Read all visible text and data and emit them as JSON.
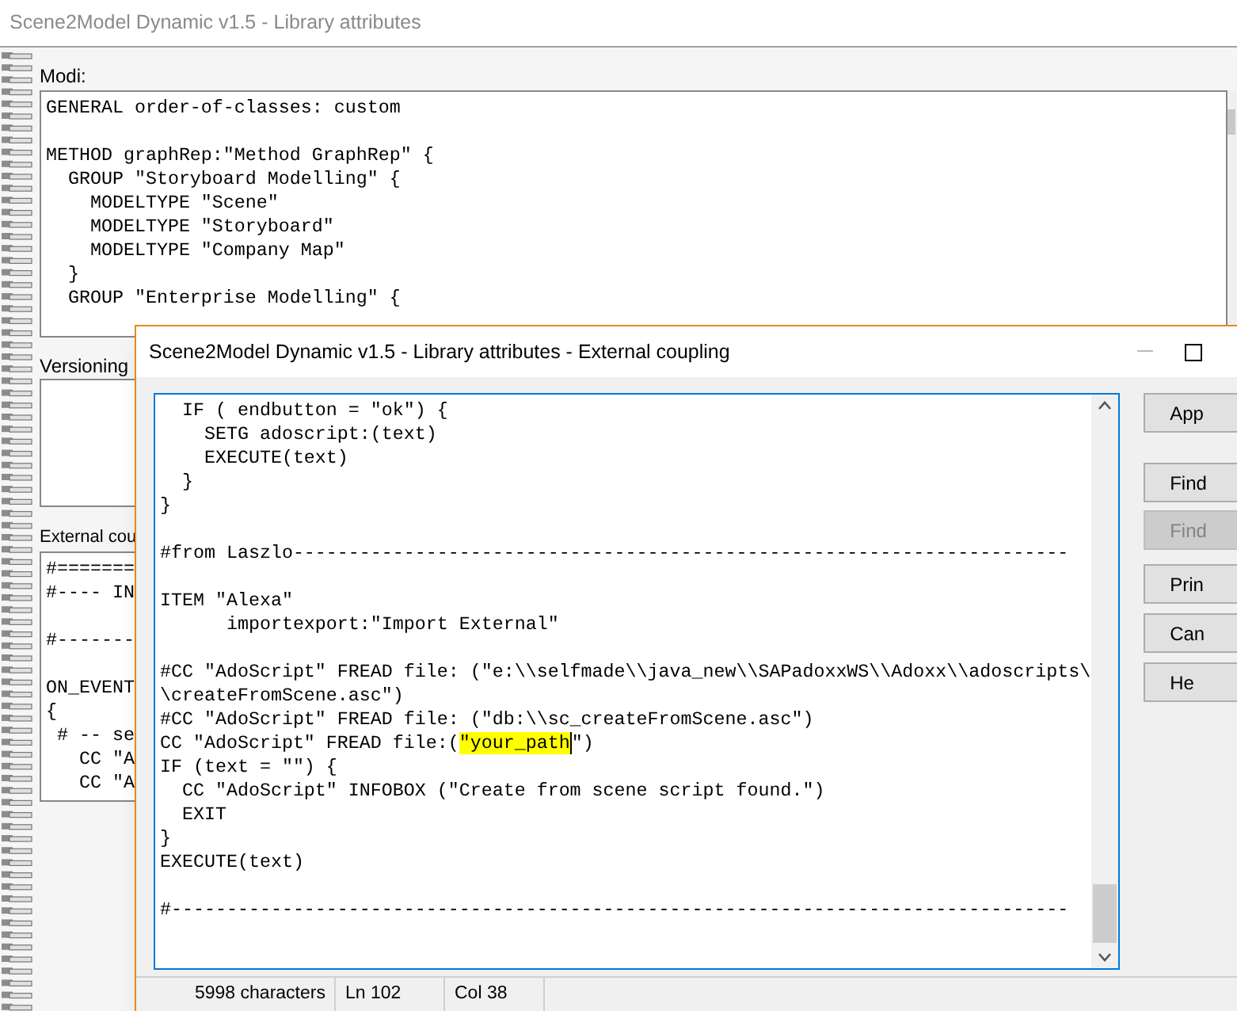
{
  "main_window": {
    "title": "Scene2Model Dynamic v1.5 - Library attributes",
    "modi": {
      "label": "Modi:",
      "lines": [
        {
          "kind": "plain",
          "text": "GENERAL order-of-classes: custom"
        },
        {
          "kind": "blank"
        },
        {
          "kind": "plain",
          "text": "METHOD graphRep:\"Method GraphRep\" {"
        },
        {
          "kind": "plain",
          "text": "  GROUP \"Storyboard Modelling\" {"
        },
        {
          "kind": "plain",
          "text": "    MODELTYPE \"Scene\""
        },
        {
          "kind": "plain",
          "text": "    MODELTYPE \"Storyboard\""
        },
        {
          "kind": "plain",
          "text": "    MODELTYPE \"Company Map\""
        },
        {
          "kind": "plain",
          "text": "  }"
        },
        {
          "kind": "plain",
          "text": "  GROUP \"Enterprise Modelling\" {"
        }
      ]
    },
    "versioning": {
      "label": "Versioning"
    },
    "external_coupling": {
      "label": "External cou",
      "lines": [
        {
          "kind": "plain",
          "text": "#======="
        },
        {
          "kind": "plain",
          "text": "#---- IN"
        },
        {
          "kind": "blank"
        },
        {
          "kind": "plain",
          "text": "#-------"
        },
        {
          "kind": "blank"
        },
        {
          "kind": "plain",
          "text": "ON_EVENT"
        },
        {
          "kind": "plain",
          "text": "{"
        },
        {
          "kind": "plain",
          "text": " # -- se"
        },
        {
          "kind": "plain",
          "text": "   CC \"A"
        },
        {
          "kind": "plain",
          "text": "   CC \"A"
        }
      ]
    }
  },
  "dialog": {
    "title": "Scene2Model Dynamic v1.5 - Library attributes - External coupling",
    "editor": {
      "lines": [
        {
          "kind": "plain",
          "text": "  IF ( endbutton = \"ok\") {"
        },
        {
          "kind": "plain",
          "text": "    SETG adoscript:(text)"
        },
        {
          "kind": "plain",
          "text": "    EXECUTE(text)"
        },
        {
          "kind": "plain",
          "text": "  }"
        },
        {
          "kind": "plain",
          "text": "}"
        },
        {
          "kind": "blank"
        },
        {
          "kind": "plain",
          "text": "#from Laszlo----------------------------------------------------------------------"
        },
        {
          "kind": "blank"
        },
        {
          "kind": "plain",
          "text": "ITEM \"Alexa\""
        },
        {
          "kind": "plain",
          "text": "      importexport:\"Import External\""
        },
        {
          "kind": "blank"
        },
        {
          "kind": "plain",
          "text": "#CC \"AdoScript\" FREAD file: (\"e:\\\\selfmade\\\\java_new\\\\SAPadoxxWS\\\\Adoxx\\\\adoscripts\\"
        },
        {
          "kind": "plain",
          "text": "\\createFromScene.asc\")"
        },
        {
          "kind": "plain",
          "text": "#CC \"AdoScript\" FREAD file: (\"db:\\\\sc_createFromScene.asc\")"
        },
        {
          "kind": "marked",
          "before": "CC \"AdoScript\" FREAD file:(",
          "marked": "\"your_path",
          "after": "\")"
        },
        {
          "kind": "plain",
          "text": "IF (text = \"\") {"
        },
        {
          "kind": "plain",
          "text": "  CC \"AdoScript\" INFOBOX (\"Create from scene script found.\")"
        },
        {
          "kind": "plain",
          "text": "  EXIT"
        },
        {
          "kind": "plain",
          "text": "}"
        },
        {
          "kind": "plain",
          "text": "EXECUTE(text)"
        },
        {
          "kind": "blank"
        },
        {
          "kind": "plain",
          "text": "#---------------------------------------------------------------------------------"
        }
      ]
    },
    "buttons": [
      {
        "label": "App",
        "disabled": false
      },
      {
        "label": "Find",
        "disabled": false
      },
      {
        "label": "Find",
        "disabled": true
      },
      {
        "label": "Prin",
        "disabled": false
      },
      {
        "label": "Can",
        "disabled": false
      },
      {
        "label": "He",
        "disabled": false
      }
    ],
    "status_bar": [
      "5998 characters",
      "Ln 102",
      "Col 38"
    ]
  }
}
